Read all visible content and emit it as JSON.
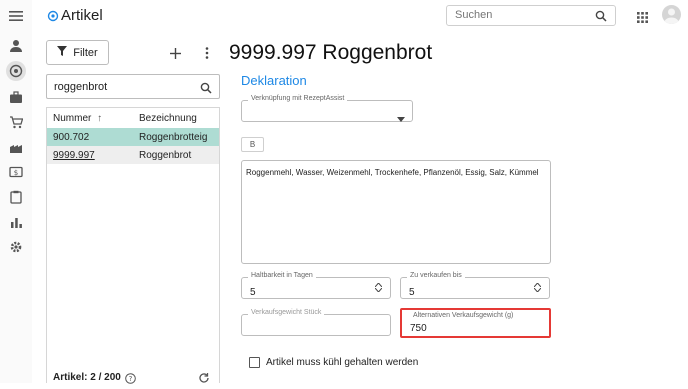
{
  "app": {
    "title": "Artikel"
  },
  "search": {
    "placeholder": "Suchen"
  },
  "sidebar": {
    "icons": [
      "menu-icon",
      "person-icon",
      "article-icon",
      "briefcase-icon",
      "cart-icon",
      "factory-icon",
      "money-icon",
      "clipboard-icon",
      "bar-chart-icon",
      "settings-icon"
    ]
  },
  "list_panel": {
    "filter_label": "Filter",
    "search_value": "roggenbrot",
    "columns": [
      "Nummer",
      "Bezeichnung"
    ],
    "rows": [
      {
        "nummer": "900.702",
        "bezeichnung": "Roggenbrotteig"
      },
      {
        "nummer": "9999.997",
        "bezeichnung": "Roggenbrot"
      }
    ],
    "footer": "Artikel: 2 / 200"
  },
  "main": {
    "heading": "9999.997 Roggenbrot",
    "section": "Deklaration",
    "verknuepfung_label": "Verknüpfung mit RezeptAssist",
    "chip_label": "B",
    "zutaten": "Roggenmehl, Wasser, Weizenmehl, Trockenhefe, Pflanzenöl, Essig, Salz, Kümmel",
    "haltbarkeit": {
      "label": "Haltbarkeit in Tagen",
      "value": "5"
    },
    "zu_verkaufen": {
      "label": "Zu verkaufen bis",
      "value": "5"
    },
    "verkaufsgewicht": {
      "label": "Verkaufsgewicht Stück",
      "value": ""
    },
    "alt_gewicht": {
      "label": "Alternativen Verkaufsgewicht (g)",
      "value": "750",
      "highlight_color": "#e53935"
    },
    "checkbox_label": "Artikel muss kühl gehalten werden"
  },
  "colors": {
    "accent": "#1e88e5",
    "selected_row": "#aedcd3",
    "highlight": "#e53935"
  }
}
